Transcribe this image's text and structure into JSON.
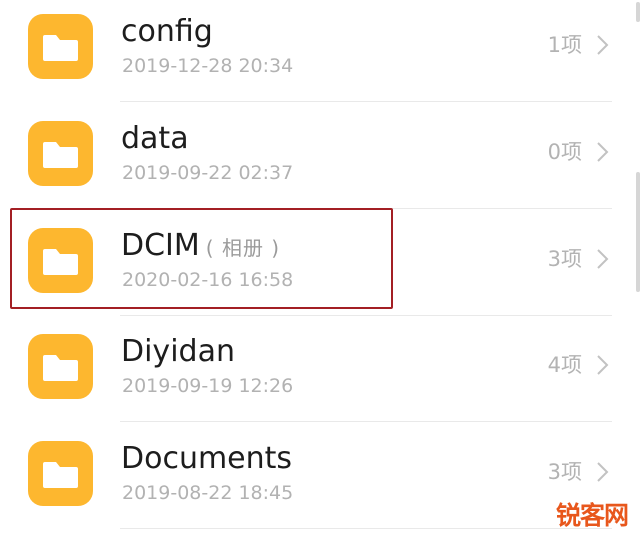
{
  "folders": [
    {
      "name": "config",
      "alias": "",
      "date": "2019-12-28 20:34",
      "count": "1项"
    },
    {
      "name": "data",
      "alias": "",
      "date": "2019-09-22 02:37",
      "count": "0项"
    },
    {
      "name": "DCIM",
      "alias": "( 相册 )",
      "date": "2020-02-16 16:58",
      "count": "3项"
    },
    {
      "name": "Diyidan",
      "alias": "",
      "date": "2019-09-19 12:26",
      "count": "4项"
    },
    {
      "name": "Documents",
      "alias": "",
      "date": "2019-08-22 18:45",
      "count": "3项"
    }
  ],
  "highlighted_folder": "DCIM",
  "watermark": "锐客网",
  "colors": {
    "folder": "#fdb72f",
    "highlight_border": "#a31f24",
    "watermark": "#e8571c"
  },
  "icons": {
    "folder": "folder-icon",
    "chevron": "chevron-right-icon"
  }
}
